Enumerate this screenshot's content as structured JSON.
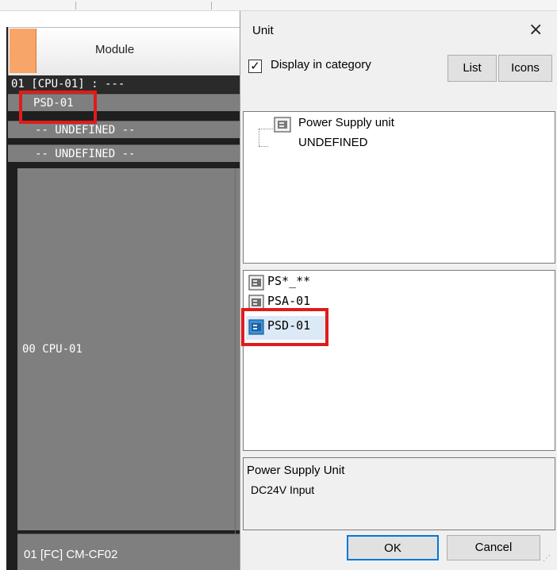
{
  "left_panel": {
    "header": "Module",
    "slot_row": "01 [CPU-01] : ---",
    "slot_items": [
      "PSD-01",
      "-- UNDEFINED --",
      "-- UNDEFINED --"
    ],
    "cpu_label": "00  CPU-01",
    "bottom_label": "01 [FC] CM-CF02"
  },
  "dialog": {
    "title": "Unit",
    "close_glyph": "×",
    "checkbox": {
      "label": "Display in category",
      "checked": true,
      "mark": "✓"
    },
    "buttons": {
      "list": "List",
      "icons": "Icons"
    },
    "tree": {
      "category": "Power Supply unit",
      "child": "UNDEFINED"
    },
    "units": [
      "PS*_**",
      "PSA-01",
      "PSD-01"
    ],
    "selected_unit": "PSD-01",
    "description": {
      "line1": "Power Supply Unit",
      "line2": "DC24V Input"
    },
    "ok": "OK",
    "cancel": "Cancel",
    "resize_grip": "⋰"
  },
  "icons": {
    "tree_category": "module-icon",
    "unit_item": "module-icon",
    "highlight_color": "#e01b1b",
    "selection_color": "#3a8fd6"
  }
}
